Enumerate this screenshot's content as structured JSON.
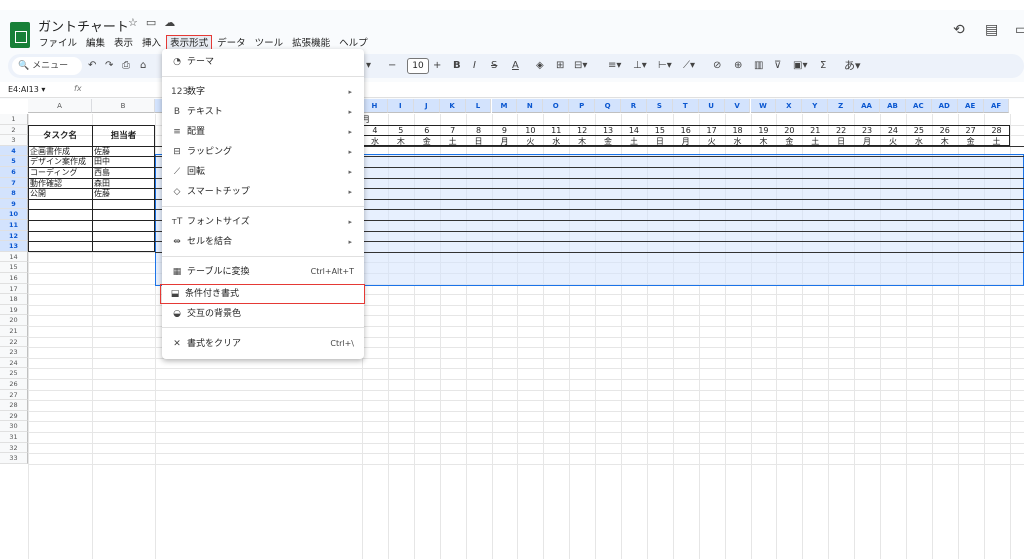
{
  "document": {
    "title": "ガントチャート"
  },
  "menubar": [
    "ファイル",
    "編集",
    "表示",
    "挿入",
    "表示形式",
    "データ",
    "ツール",
    "拡張機能",
    "ヘルプ"
  ],
  "toolbar": {
    "search_label": "メニュー",
    "font_size": "10"
  },
  "formula_bar": {
    "cell_ref": "E4:AI13",
    "fx": "fx"
  },
  "grid": {
    "columns": [
      "A",
      "B",
      "",
      "",
      "",
      "",
      "",
      "",
      "",
      "",
      "",
      "",
      "",
      "H",
      "I",
      "J",
      "K",
      "L",
      "M",
      "N",
      "O",
      "P",
      "Q",
      "R",
      "S",
      "T",
      "U",
      "V",
      "W",
      "X",
      "Y",
      "Z",
      "AA",
      "AB",
      "AC",
      "AD",
      "AE",
      "AF"
    ],
    "month_label": "月",
    "header_task": "タスク名",
    "header_owner": "担当者",
    "days": [
      "4",
      "5",
      "6",
      "7",
      "8",
      "9",
      "10",
      "11",
      "12",
      "13",
      "14",
      "15",
      "16",
      "17",
      "18",
      "19",
      "20",
      "21",
      "22",
      "23",
      "24",
      "25",
      "26",
      "27",
      "28"
    ],
    "weekdays": [
      "水",
      "木",
      "金",
      "土",
      "日",
      "月",
      "火",
      "水",
      "木",
      "金",
      "土",
      "日",
      "月",
      "火",
      "水",
      "木",
      "金",
      "土",
      "日",
      "月",
      "火",
      "水",
      "木",
      "金",
      "土"
    ],
    "tasks": [
      {
        "name": "企画書作成",
        "owner": "佐藤"
      },
      {
        "name": "デザイン案作成",
        "owner": "田中"
      },
      {
        "name": "コーディング",
        "owner": "西島"
      },
      {
        "name": "動作確認",
        "owner": "森田"
      },
      {
        "name": "公開",
        "owner": "佐藤"
      }
    ],
    "row_numbers": [
      "1",
      "2",
      "3",
      "4",
      "5",
      "6",
      "7",
      "8",
      "9",
      "10",
      "11",
      "12",
      "13",
      "14",
      "15",
      "16",
      "17",
      "18",
      "19",
      "20",
      "21",
      "22",
      "23",
      "24",
      "25",
      "26",
      "27",
      "28",
      "29",
      "30",
      "31",
      "32",
      "33"
    ]
  },
  "format_menu": {
    "items": [
      {
        "icon": "palette-icon",
        "glyph": "◔",
        "label": "テーマ",
        "arrow": "",
        "shortcut": ""
      },
      {
        "icon": "number-icon",
        "glyph": "123",
        "label": "数字",
        "arrow": "▸",
        "shortcut": ""
      },
      {
        "icon": "bold-icon",
        "glyph": "B",
        "label": "テキスト",
        "arrow": "▸",
        "shortcut": ""
      },
      {
        "icon": "align-icon",
        "glyph": "≡",
        "label": "配置",
        "arrow": "▸",
        "shortcut": ""
      },
      {
        "icon": "wrap-icon",
        "glyph": "⊟",
        "label": "ラッピング",
        "arrow": "▸",
        "shortcut": ""
      },
      {
        "icon": "rotate-icon",
        "glyph": "⟋",
        "label": "回転",
        "arrow": "▸",
        "shortcut": ""
      },
      {
        "icon": "smart-chip-icon",
        "glyph": "◇",
        "label": "スマートチップ",
        "arrow": "▸",
        "shortcut": ""
      },
      {
        "icon": "font-size-icon",
        "glyph": "тT",
        "label": "フォントサイズ",
        "arrow": "▸",
        "shortcut": ""
      },
      {
        "icon": "merge-icon",
        "glyph": "⇹",
        "label": "セルを結合",
        "arrow": "▸",
        "shortcut": ""
      },
      {
        "icon": "table-icon",
        "glyph": "▦",
        "label": "テーブルに変換",
        "arrow": "",
        "shortcut": "Ctrl+Alt+T"
      },
      {
        "icon": "conditional-format-icon",
        "glyph": "⬓",
        "label": "条件付き書式",
        "arrow": "",
        "shortcut": ""
      },
      {
        "icon": "alternating-colors-icon",
        "glyph": "◒",
        "label": "交互の背景色",
        "arrow": "",
        "shortcut": ""
      },
      {
        "icon": "clear-format-icon",
        "glyph": "✕",
        "label": "書式をクリア",
        "arrow": "",
        "shortcut": "Ctrl+\\"
      }
    ]
  }
}
